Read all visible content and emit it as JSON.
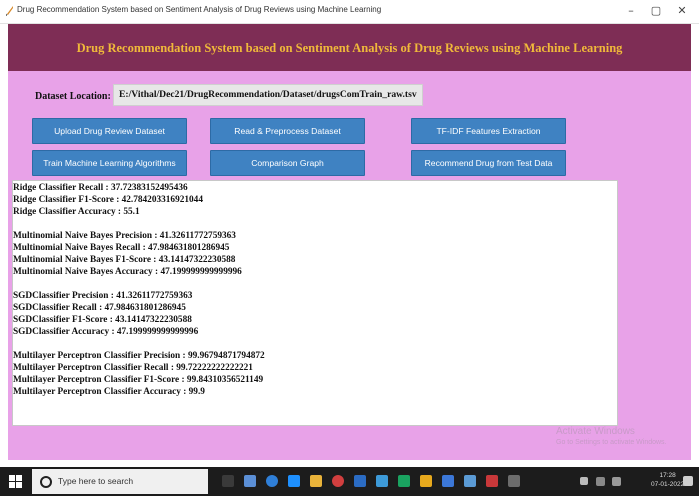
{
  "window": {
    "title": "Drug Recommendation System based on Sentiment Analysis of Drug Reviews using Machine Learning",
    "minimize": "–",
    "maximize": "▢",
    "close": "✕"
  },
  "header": {
    "title": "Drug Recommendation System based on Sentiment Analysis of Drug Reviews using Machine Learning"
  },
  "dataset": {
    "label": "Dataset Location:",
    "path": "E:/Vithal/Dec21/DrugRecommendation/Dataset/drugsComTrain_raw.tsv"
  },
  "buttons": {
    "upload": "Upload Drug Review Dataset",
    "preprocess": "Read & Preprocess Dataset",
    "tfidf": "TF-IDF Features Extraction",
    "train": "Train Machine Learning Algorithms",
    "graph": "Comparison Graph",
    "recommend": "Recommend Drug from Test Data"
  },
  "output": {
    "lines": [
      "Ridge Classifier Recall    : 37.72383152495436",
      "Ridge Classifier F1-Score  : 42.784203316921044",
      "Ridge Classifier Accuracy  : 55.1",
      "",
      "Multinomial Naive Bayes Precision : 41.32611772759363",
      "Multinomial Naive Bayes Recall    : 47.984631801286945",
      "Multinomial Naive Bayes F1-Score  : 43.14147322230588",
      "Multinomial Naive Bayes Accuracy  : 47.199999999999996",
      "",
      "SGDClassifier Precision  : 41.32611772759363",
      "SGDClassifier Recall     : 47.984631801286945",
      "SGDClassifier F1-Score   : 43.14147322230588",
      "SGDClassifier Accuracy   : 47.199999999999996",
      "",
      "Multilayer Perceptron Classifier Precision  : 99.96794871794872",
      "Multilayer Perceptron Classifier Recall     : 99.72222222222221",
      "Multilayer Perceptron Classifier F1-Score   : 99.84310356521149",
      "Multilayer Perceptron Classifier Accuracy   : 99.9"
    ]
  },
  "watermark": {
    "line1": "Activate Windows",
    "line2": "Go to Settings to activate Windows."
  },
  "taskbar": {
    "search_placeholder": "Type here to search",
    "time": "17:28",
    "date": "07-01-2022"
  },
  "colors": {
    "header_bg": "#7e2d55",
    "header_text": "#f0b93a",
    "app_bg": "#e8a2e8",
    "button_bg": "#3f82c2"
  }
}
